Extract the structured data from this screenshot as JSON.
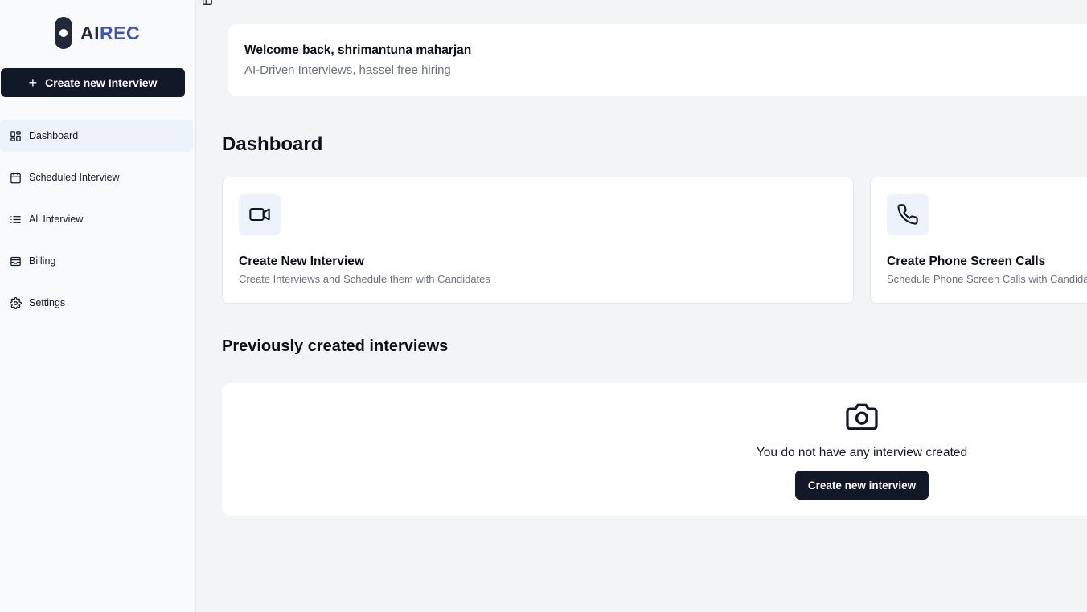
{
  "brand": {
    "part1": "AI",
    "part2": "REC"
  },
  "sidebar": {
    "create_label": "Create new Interview",
    "items": [
      {
        "label": "Dashboard",
        "icon": "layout-dashboard-icon"
      },
      {
        "label": "Scheduled Interview",
        "icon": "calendar-icon"
      },
      {
        "label": "All Interview",
        "icon": "list-icon"
      },
      {
        "label": "Billing",
        "icon": "wallet-icon"
      },
      {
        "label": "Settings",
        "icon": "gear-icon"
      }
    ]
  },
  "welcome": {
    "title": "Welcome back, shrimantuna maharjan",
    "subtitle": "AI-Driven Interviews, hassel free hiring"
  },
  "dashboard": {
    "title": "Dashboard",
    "cards": [
      {
        "title": "Create New Interview",
        "description": "Create Interviews and Schedule them with Candidates",
        "icon": "video-icon"
      },
      {
        "title": "Create Phone Screen Calls",
        "description": "Schedule Phone Screen Calls with Candidates",
        "icon": "phone-icon"
      }
    ]
  },
  "previous": {
    "title": "Previously created interviews",
    "empty_text": "You do not have any interview created",
    "button_label": "Create new interview",
    "icon": "camera-icon"
  },
  "colors": {
    "primary": "#111827",
    "brand_accent": "#3f51b5",
    "active_nav_bg": "#eef2fb"
  }
}
